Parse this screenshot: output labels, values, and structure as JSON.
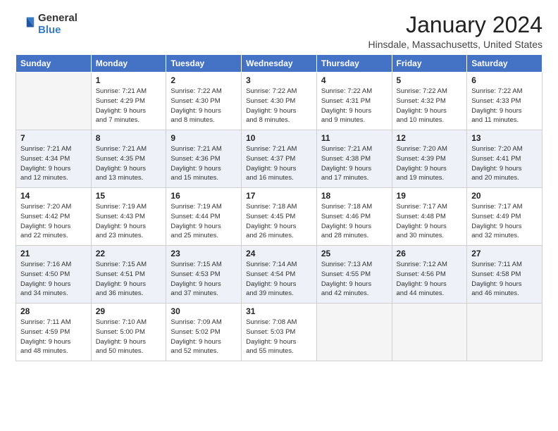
{
  "logo": {
    "general": "General",
    "blue": "Blue"
  },
  "title": "January 2024",
  "location": "Hinsdale, Massachusetts, United States",
  "weekdays": [
    "Sunday",
    "Monday",
    "Tuesday",
    "Wednesday",
    "Thursday",
    "Friday",
    "Saturday"
  ],
  "weeks": [
    [
      {
        "day": "",
        "empty": true
      },
      {
        "day": "1",
        "sunrise": "7:21 AM",
        "sunset": "4:29 PM",
        "daylight": "9 hours and 7 minutes."
      },
      {
        "day": "2",
        "sunrise": "7:22 AM",
        "sunset": "4:30 PM",
        "daylight": "9 hours and 8 minutes."
      },
      {
        "day": "3",
        "sunrise": "7:22 AM",
        "sunset": "4:30 PM",
        "daylight": "9 hours and 8 minutes."
      },
      {
        "day": "4",
        "sunrise": "7:22 AM",
        "sunset": "4:31 PM",
        "daylight": "9 hours and 9 minutes."
      },
      {
        "day": "5",
        "sunrise": "7:22 AM",
        "sunset": "4:32 PM",
        "daylight": "9 hours and 10 minutes."
      },
      {
        "day": "6",
        "sunrise": "7:22 AM",
        "sunset": "4:33 PM",
        "daylight": "9 hours and 11 minutes."
      }
    ],
    [
      {
        "day": "7",
        "sunrise": "7:21 AM",
        "sunset": "4:34 PM",
        "daylight": "9 hours and 12 minutes."
      },
      {
        "day": "8",
        "sunrise": "7:21 AM",
        "sunset": "4:35 PM",
        "daylight": "9 hours and 13 minutes."
      },
      {
        "day": "9",
        "sunrise": "7:21 AM",
        "sunset": "4:36 PM",
        "daylight": "9 hours and 15 minutes."
      },
      {
        "day": "10",
        "sunrise": "7:21 AM",
        "sunset": "4:37 PM",
        "daylight": "9 hours and 16 minutes."
      },
      {
        "day": "11",
        "sunrise": "7:21 AM",
        "sunset": "4:38 PM",
        "daylight": "9 hours and 17 minutes."
      },
      {
        "day": "12",
        "sunrise": "7:20 AM",
        "sunset": "4:39 PM",
        "daylight": "9 hours and 19 minutes."
      },
      {
        "day": "13",
        "sunrise": "7:20 AM",
        "sunset": "4:41 PM",
        "daylight": "9 hours and 20 minutes."
      }
    ],
    [
      {
        "day": "14",
        "sunrise": "7:20 AM",
        "sunset": "4:42 PM",
        "daylight": "9 hours and 22 minutes."
      },
      {
        "day": "15",
        "sunrise": "7:19 AM",
        "sunset": "4:43 PM",
        "daylight": "9 hours and 23 minutes."
      },
      {
        "day": "16",
        "sunrise": "7:19 AM",
        "sunset": "4:44 PM",
        "daylight": "9 hours and 25 minutes."
      },
      {
        "day": "17",
        "sunrise": "7:18 AM",
        "sunset": "4:45 PM",
        "daylight": "9 hours and 26 minutes."
      },
      {
        "day": "18",
        "sunrise": "7:18 AM",
        "sunset": "4:46 PM",
        "daylight": "9 hours and 28 minutes."
      },
      {
        "day": "19",
        "sunrise": "7:17 AM",
        "sunset": "4:48 PM",
        "daylight": "9 hours and 30 minutes."
      },
      {
        "day": "20",
        "sunrise": "7:17 AM",
        "sunset": "4:49 PM",
        "daylight": "9 hours and 32 minutes."
      }
    ],
    [
      {
        "day": "21",
        "sunrise": "7:16 AM",
        "sunset": "4:50 PM",
        "daylight": "9 hours and 34 minutes."
      },
      {
        "day": "22",
        "sunrise": "7:15 AM",
        "sunset": "4:51 PM",
        "daylight": "9 hours and 36 minutes."
      },
      {
        "day": "23",
        "sunrise": "7:15 AM",
        "sunset": "4:53 PM",
        "daylight": "9 hours and 37 minutes."
      },
      {
        "day": "24",
        "sunrise": "7:14 AM",
        "sunset": "4:54 PM",
        "daylight": "9 hours and 39 minutes."
      },
      {
        "day": "25",
        "sunrise": "7:13 AM",
        "sunset": "4:55 PM",
        "daylight": "9 hours and 42 minutes."
      },
      {
        "day": "26",
        "sunrise": "7:12 AM",
        "sunset": "4:56 PM",
        "daylight": "9 hours and 44 minutes."
      },
      {
        "day": "27",
        "sunrise": "7:11 AM",
        "sunset": "4:58 PM",
        "daylight": "9 hours and 46 minutes."
      }
    ],
    [
      {
        "day": "28",
        "sunrise": "7:11 AM",
        "sunset": "4:59 PM",
        "daylight": "9 hours and 48 minutes."
      },
      {
        "day": "29",
        "sunrise": "7:10 AM",
        "sunset": "5:00 PM",
        "daylight": "9 hours and 50 minutes."
      },
      {
        "day": "30",
        "sunrise": "7:09 AM",
        "sunset": "5:02 PM",
        "daylight": "9 hours and 52 minutes."
      },
      {
        "day": "31",
        "sunrise": "7:08 AM",
        "sunset": "5:03 PM",
        "daylight": "9 hours and 55 minutes."
      },
      {
        "day": "",
        "empty": true
      },
      {
        "day": "",
        "empty": true
      },
      {
        "day": "",
        "empty": true
      }
    ]
  ],
  "labels": {
    "sunrise": "Sunrise:",
    "sunset": "Sunset:",
    "daylight": "Daylight:"
  }
}
